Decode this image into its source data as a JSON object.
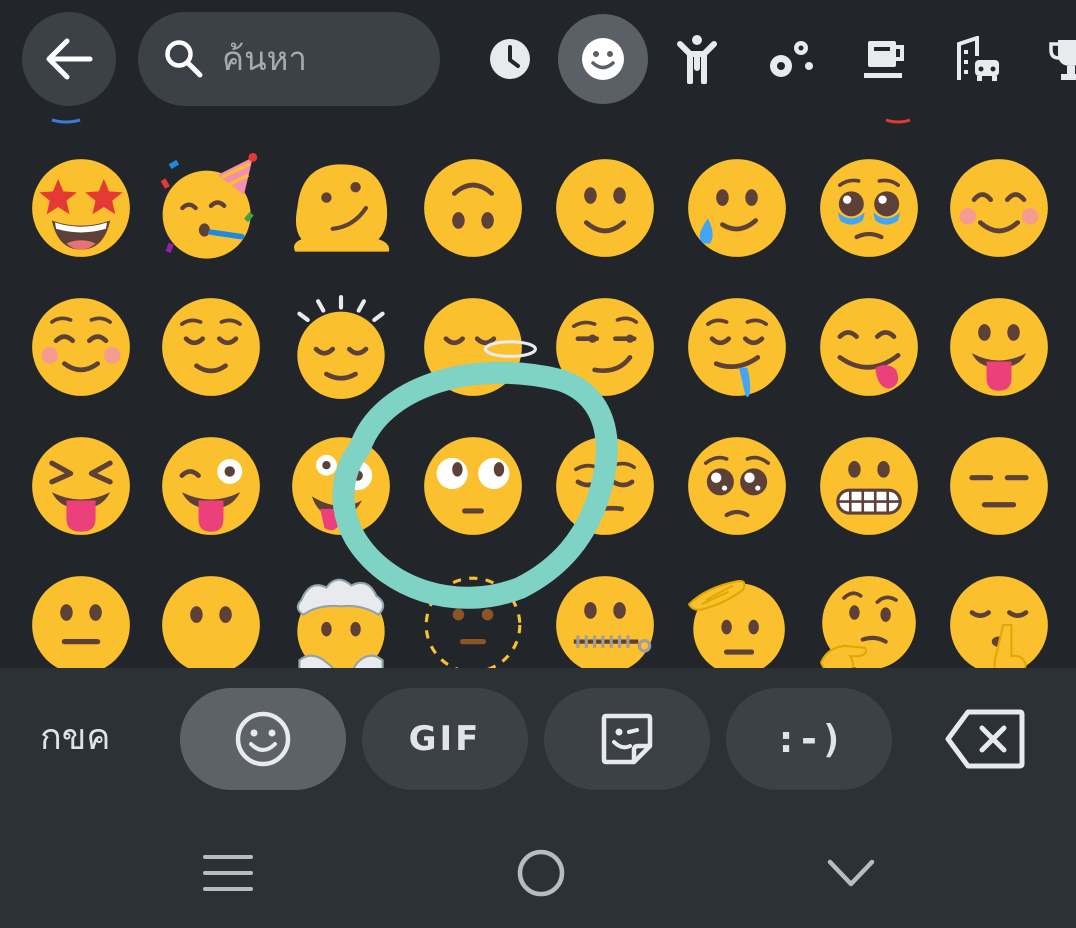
{
  "search": {
    "placeholder": "ค้นหา"
  },
  "categories": [
    {
      "name": "recent",
      "icon": "clock-icon",
      "active": false
    },
    {
      "name": "smileys",
      "icon": "smiley-icon",
      "active": true
    },
    {
      "name": "people",
      "icon": "person-icon",
      "active": false
    },
    {
      "name": "animals-nature",
      "icon": "flower-icon",
      "active": false
    },
    {
      "name": "food",
      "icon": "cup-icon",
      "active": false
    },
    {
      "name": "travel",
      "icon": "building-car-icon",
      "active": false
    },
    {
      "name": "activities",
      "icon": "trophy-icon",
      "active": false
    }
  ],
  "emoji_rows": [
    [
      "star-struck",
      "partying-face",
      "melting-face",
      "upside-down-face",
      "slightly-smiling-face",
      "face-holding-back-tears",
      "pleading-teary-face",
      "smiling-face-with-smiling-eyes"
    ],
    [
      "smiling-face",
      "relieved-face",
      "relieved-face-with-lines",
      "face-with-spiral-halo",
      "smirking-face",
      "drooling-face",
      "face-savoring-food",
      "face-with-tongue"
    ],
    [
      "squinting-face-with-tongue",
      "winking-face-with-tongue",
      "zany-face",
      "face-with-wide-eyes",
      "sideways-glance-face",
      "pleading-face",
      "grimacing-face",
      "expressionless-face"
    ],
    [
      "neutral-face",
      "face-without-mouth",
      "exploding-head",
      "dotted-line-face",
      "zipper-mouth-face",
      "saluting-face",
      "thinking-face",
      "shushing-face"
    ]
  ],
  "annotation": {
    "color": "#7fd3c4",
    "target": "face-with-wide-eyes"
  },
  "tabbar": {
    "abc_label": "กขค",
    "tabs": [
      {
        "name": "emoji",
        "icon": "smiley-icon",
        "active": true
      },
      {
        "name": "gif",
        "label": "GIF",
        "active": false
      },
      {
        "name": "sticker",
        "icon": "sticker-icon",
        "active": false
      },
      {
        "name": "emoticon",
        "label": ":-)",
        "active": false
      }
    ],
    "backspace_icon": "backspace-icon"
  },
  "navbar": {
    "items": [
      "menu-icon",
      "home-icon",
      "chevron-down-icon"
    ]
  },
  "colors": {
    "background": "#22262b",
    "emoji_yellow": "#fbc02d",
    "annotation": "#7fd3c4"
  }
}
